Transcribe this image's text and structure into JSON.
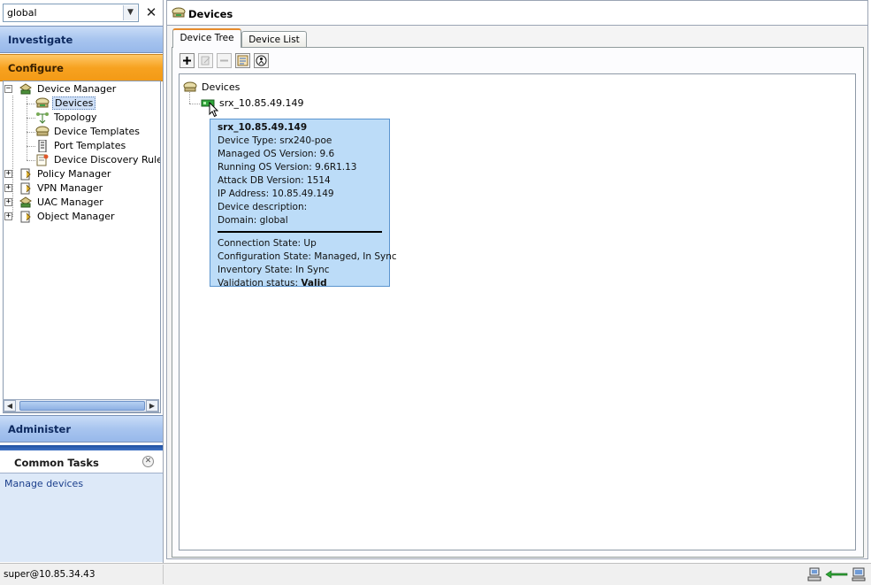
{
  "domain_selector": {
    "value": "global"
  },
  "nav": {
    "investigate": "Investigate",
    "configure": "Configure",
    "administer": "Administer"
  },
  "tree": {
    "device_manager": "Device Manager",
    "devices": "Devices",
    "topology": "Topology",
    "device_templates": "Device Templates",
    "port_templates": "Port Templates",
    "device_discovery_rules": "Device Discovery Rules",
    "policy_manager": "Policy Manager",
    "vpn_manager": "VPN Manager",
    "uac_manager": "UAC Manager",
    "object_manager": "Object Manager"
  },
  "common_tasks": {
    "title": "Common Tasks",
    "link": "Manage devices"
  },
  "main": {
    "title": "Devices",
    "tabs": [
      "Device Tree",
      "Device List"
    ],
    "toolbar": [
      "add-icon",
      "edit-icon",
      "delete-icon",
      "view-icon",
      "device-details-icon"
    ]
  },
  "device_tree": {
    "root": "Devices",
    "device": "srx_10.85.49.149"
  },
  "tooltip": {
    "name": "srx_10.85.49.149",
    "device_type": "Device Type: srx240-poe",
    "managed_os": "Managed OS Version: 9.6",
    "running_os": "Running OS Version: 9.6R1.13",
    "attack_db": "Attack DB Version: 1514",
    "ip_address": "IP Address: 10.85.49.149",
    "description": "Device description:",
    "domain": "Domain: global",
    "connection_state": "Connection State: Up",
    "config_state": "Configuration State: Managed, In Sync",
    "inventory_state": "Inventory State: In Sync",
    "validation_label": "Validation status: ",
    "validation_value": "Valid"
  },
  "status_bar": {
    "user": "super@10.85.34.43"
  },
  "colors": {
    "nav_blue": "#a8c5ef",
    "nav_orange": "#f7a220",
    "tooltip_bg": "#bcdcf8",
    "device_up": "#2fa63a"
  }
}
